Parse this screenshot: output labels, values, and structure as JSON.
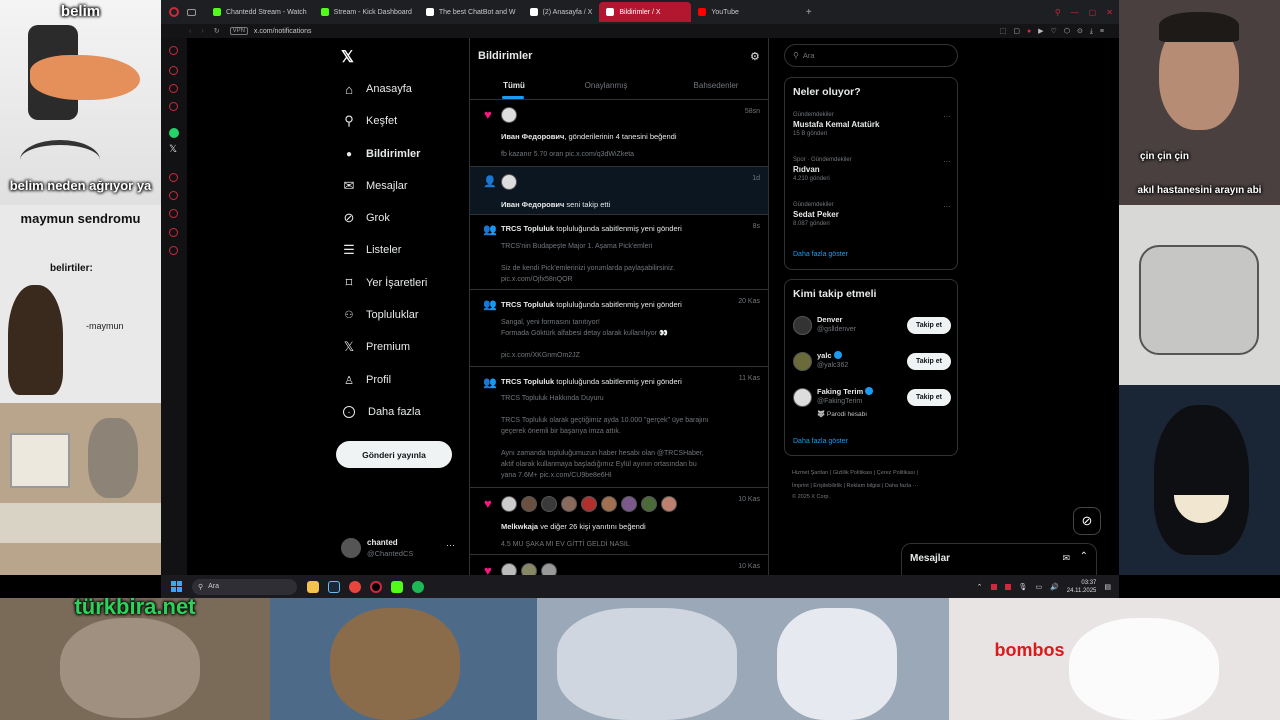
{
  "overlays": {
    "left_top_caption": "belim",
    "left_mid_caption": "belim neden ağrıyor ya",
    "monkey_title": "maymun sendromu",
    "monkey_symptoms": "belirtiler:",
    "monkey_sign": "-maymun",
    "right_cam_caption1": "çin çin çin",
    "right_cam_caption2": "akıl hastanesini arayın abi",
    "bottom_left_caption": "türkbira.net",
    "bottom_right_caption": "bombos"
  },
  "browser": {
    "tabs": [
      {
        "label": "Chantedd Stream - Watch",
        "color": "#53fc18"
      },
      {
        "label": "Stream - Kick Dashboard",
        "color": "#53fc18"
      },
      {
        "label": "The best ChatBot and W",
        "color": "#ffffff"
      },
      {
        "label": "(2) Anasayfa / X",
        "color": "#ffffff"
      },
      {
        "label": "Bildirimler / X",
        "color": "#ffffff"
      },
      {
        "label": "YouTube",
        "color": "#ff0000"
      }
    ],
    "vpn_badge": "VPN",
    "url": "x.com/notifications"
  },
  "nav": {
    "items": [
      {
        "label": "Anasayfa",
        "icon": "home-icon",
        "glyph": "⌂"
      },
      {
        "label": "Keşfet",
        "icon": "search-icon",
        "glyph": "⚲"
      },
      {
        "label": "Bildirimler",
        "icon": "bell-icon",
        "glyph": "🔔"
      },
      {
        "label": "Mesajlar",
        "icon": "mail-icon",
        "glyph": "✉"
      },
      {
        "label": "Grok",
        "icon": "grok-icon",
        "glyph": "⊘"
      },
      {
        "label": "Listeler",
        "icon": "list-icon",
        "glyph": "☰"
      },
      {
        "label": "Yer İşaretleri",
        "icon": "bookmark-icon",
        "glyph": "🔖"
      },
      {
        "label": "Topluluklar",
        "icon": "communities-icon",
        "glyph": "👥"
      },
      {
        "label": "Premium",
        "icon": "x-logo-icon",
        "glyph": "𝕏"
      },
      {
        "label": "Profil",
        "icon": "profile-icon",
        "glyph": "👤"
      },
      {
        "label": "Daha fazla",
        "icon": "more-circle-icon",
        "glyph": "⋯"
      }
    ],
    "post_button": "Gönderi yayınla",
    "account_name": "chanted",
    "account_handle": "@ChantedCS"
  },
  "main": {
    "title": "Bildirimler",
    "tabs": [
      "Tümü",
      "Onaylanmış",
      "Bahsedenler"
    ],
    "notifications": [
      {
        "type": "like",
        "time": "58sn",
        "actor": "Иван Федорович",
        "text": ", gönderilerinin 4 tanesini beğendi",
        "body": "fb kazanır 5.70 oran pic.x.com/q3dWiZketa"
      },
      {
        "type": "follow",
        "time": "1d",
        "actor": "Иван Федорович",
        "text": " seni takip etti",
        "body": ""
      },
      {
        "type": "community",
        "time": "8s",
        "actor": "TRCS Topluluk",
        "text": " topluluğunda sabitlenmiş yeni gönderi",
        "body_lines": [
          "TRCS'nin Budapeşte Major 1. Aşama Pick'emleri",
          "",
          "Siz de kendi Pick'emlerinizi yorumlarda paylaşabilirsiniz.",
          "pic.x.com/Ojfx58nQOR"
        ]
      },
      {
        "type": "community",
        "time": "20 Kas",
        "actor": "TRCS Topluluk",
        "text": " topluluğunda sabitlenmiş yeni gönderi",
        "body_lines": [
          "Sangal, yeni formasını tanıtıyor!",
          "Formada Göktürk alfabesi detay olarak kullanılıyor 👀",
          "",
          "pic.x.com/XKGnmOm2JZ"
        ]
      },
      {
        "type": "community",
        "time": "11 Kas",
        "actor": "TRCS Topluluk",
        "text": " topluluğunda sabitlenmiş yeni gönderi",
        "body_lines": [
          "TRCS Topluluk Hakkında Duyuru",
          "",
          "TRCS Topluluk olarak geçtiğimiz ayda 10.000 \"gerçek\" üye barajını",
          "geçerek önemli bir başarıya imza attık.",
          "",
          "Aynı zamanda topluluğumuzun haber hesabı olan @TRCSHaber,",
          "aktif olarak kullanmaya başladığımız Eylül ayının ortasından bu",
          "yana 7.6M+ pic.x.com/CU9be8e6HI"
        ]
      },
      {
        "type": "like",
        "time": "10 Kas",
        "actor": "Melkwkaja",
        "text": " ve diğer 26 kişi yanıtını beğendi",
        "body": "4.5 MU ŞAKA MI EV GİTTİ GELDİ NASIL"
      },
      {
        "type": "like",
        "time": "10 Kas",
        "actor": "",
        "text": "",
        "body": ""
      }
    ]
  },
  "right": {
    "search_placeholder": "Ara",
    "trends_title": "Neler oluyor?",
    "trends": [
      {
        "category": "Gündemdekiler",
        "name": "Mustafa Kemal Atatürk",
        "count": "15 B gönderi"
      },
      {
        "category": "Spor · Gündemdekiler",
        "name": "Rıdvan",
        "count": "4.210 gönderi"
      },
      {
        "category": "Gündemdekiler",
        "name": "Sedat Peker",
        "count": "8.087 gönderi"
      }
    ],
    "trends_more": "Daha fazla göster",
    "who_title": "Kimi takip etmeli",
    "who": [
      {
        "name": "Denver",
        "handle": "@gslldenver",
        "extra": "",
        "verified": false
      },
      {
        "name": "yalc",
        "handle": "@yalc362",
        "extra": "",
        "verified": true
      },
      {
        "name": "Faking Terim",
        "handle": "@FakingTerim",
        "extra": "🐺 Parodi hesabı",
        "verified": true
      }
    ],
    "follow_label": "Takip et",
    "who_more": "Daha fazla göster",
    "footer_line1": "Hizmet Şartları  |  Gizlilik Politikası  |  Çerez Politikası  |",
    "footer_line2": "İmprint  |  Erişilebilirlik  |  Reklam bilgisi  |  Daha fazla ···",
    "footer_line3": "© 2025 X Corp.",
    "messages_title": "Mesajlar"
  },
  "taskbar": {
    "search_placeholder": "Ara",
    "time": "03:37",
    "date": "24.11.2025"
  }
}
